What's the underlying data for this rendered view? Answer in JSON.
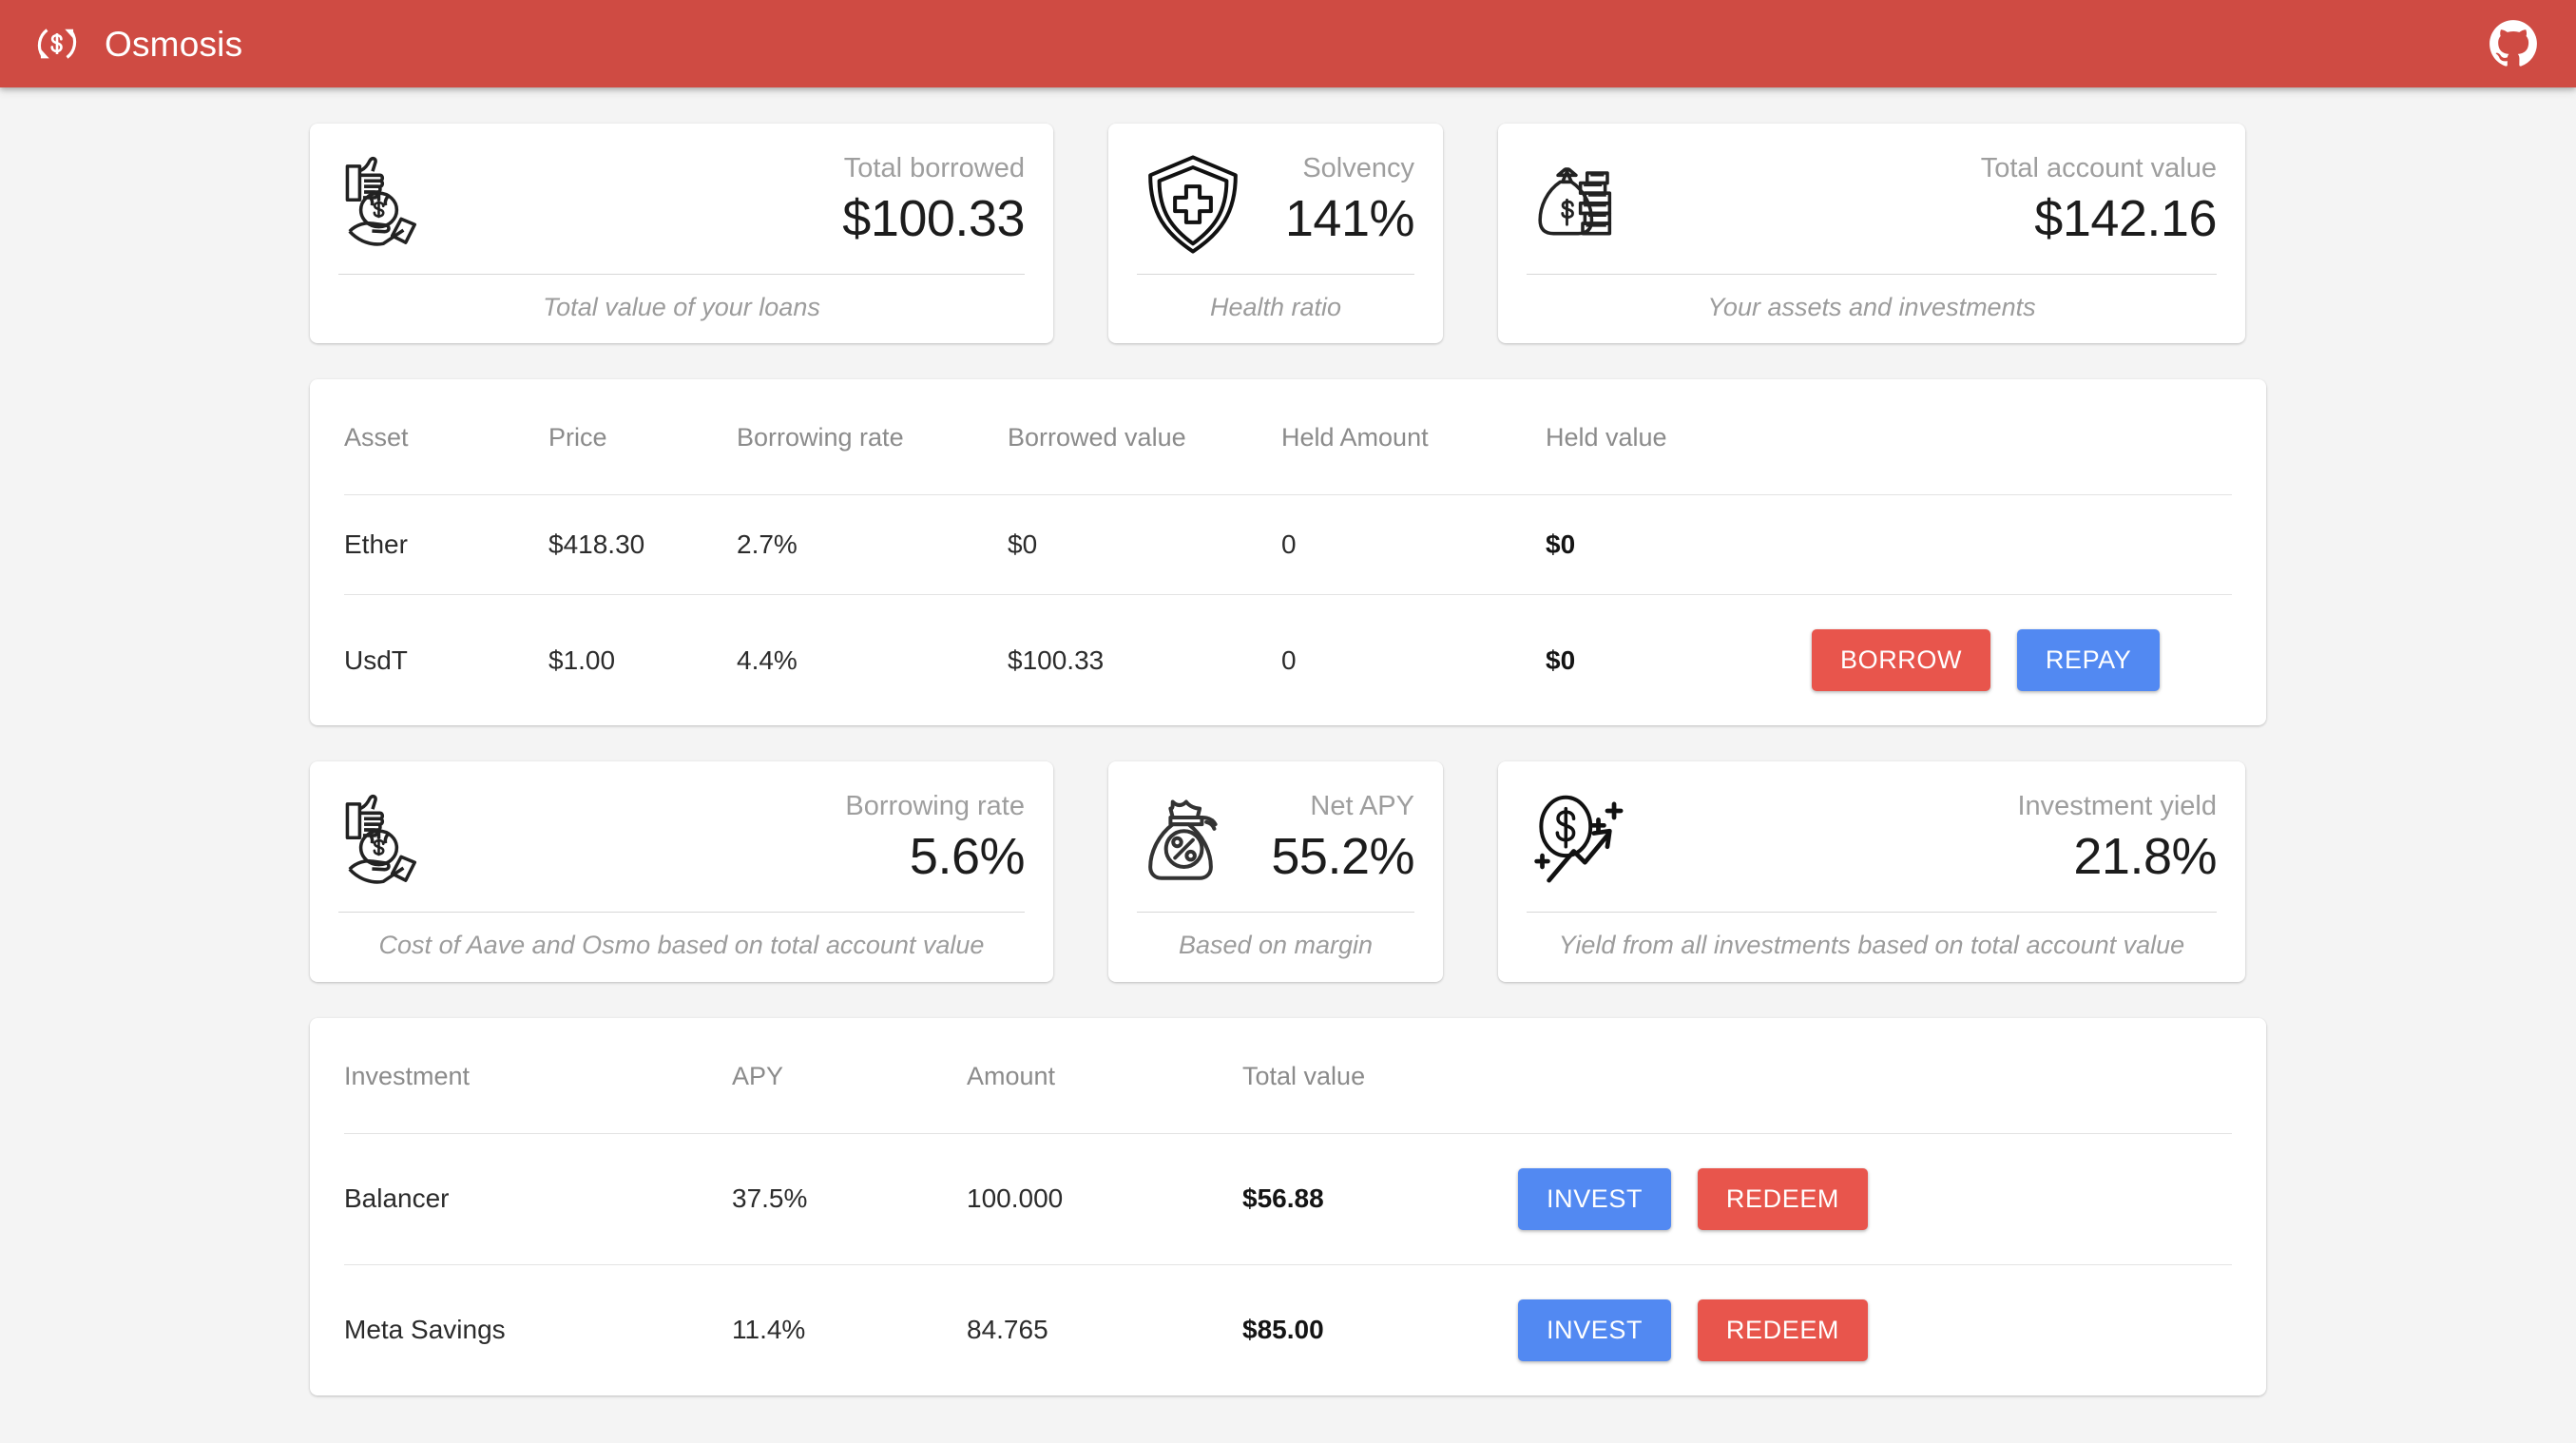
{
  "header": {
    "title": "Osmosis",
    "logo_icon": "dollar-refresh-icon",
    "github_icon": "github-icon",
    "brand_color": "#cf4b43"
  },
  "colors": {
    "background": "#f4f4f4",
    "card": "#ffffff",
    "red_button": "#e8554c",
    "blue_button": "#5289f2",
    "label_gray": "#9e9e9e"
  },
  "stats_top": [
    {
      "icon": "hand-holding-money-bag-icon",
      "label": "Total borrowed",
      "value": "$100.33",
      "caption": "Total value of your loans"
    },
    {
      "icon": "shield-plus-icon",
      "label": "Solvency",
      "value": "141%",
      "caption": "Health ratio"
    },
    {
      "icon": "money-bag-coins-icon",
      "label": "Total account value",
      "value": "$142.16",
      "caption": "Your assets and investments"
    }
  ],
  "stats_bottom": [
    {
      "icon": "hand-holding-money-bag-icon",
      "label": "Borrowing rate",
      "value": "5.6%",
      "caption": "Cost of Aave and Osmo based on total account value"
    },
    {
      "icon": "money-bag-percent-icon",
      "label": "Net APY",
      "value": "55.2%",
      "caption": "Based on margin"
    },
    {
      "icon": "dollar-growth-arrow-icon",
      "label": "Investment yield",
      "value": "21.8%",
      "caption": "Yield from all investments based on total account value"
    }
  ],
  "assets_table": {
    "headers": [
      "Asset",
      "Price",
      "Borrowing rate",
      "Borrowed value",
      "Held Amount",
      "Held value",
      ""
    ],
    "rows": [
      {
        "asset": "Ether",
        "price": "$418.30",
        "borrowing_rate": "2.7%",
        "borrowed_value": "$0",
        "held_amount": "0",
        "held_value": "$0",
        "actions": []
      },
      {
        "asset": "UsdT",
        "price": "$1.00",
        "borrowing_rate": "4.4%",
        "borrowed_value": "$100.33",
        "held_amount": "0",
        "held_value": "$0",
        "actions": [
          {
            "label": "BORROW",
            "style": "red"
          },
          {
            "label": "REPAY",
            "style": "blue"
          }
        ]
      }
    ]
  },
  "investments_table": {
    "headers": [
      "Investment",
      "APY",
      "Amount",
      "Total value",
      ""
    ],
    "rows": [
      {
        "investment": "Balancer",
        "apy": "37.5%",
        "amount": "100.000",
        "total_value": "$56.88",
        "actions": [
          {
            "label": "INVEST",
            "style": "blue"
          },
          {
            "label": "REDEEM",
            "style": "red"
          }
        ]
      },
      {
        "investment": "Meta Savings",
        "apy": "11.4%",
        "amount": "84.765",
        "total_value": "$85.00",
        "actions": [
          {
            "label": "INVEST",
            "style": "blue"
          },
          {
            "label": "REDEEM",
            "style": "red"
          }
        ]
      }
    ]
  }
}
